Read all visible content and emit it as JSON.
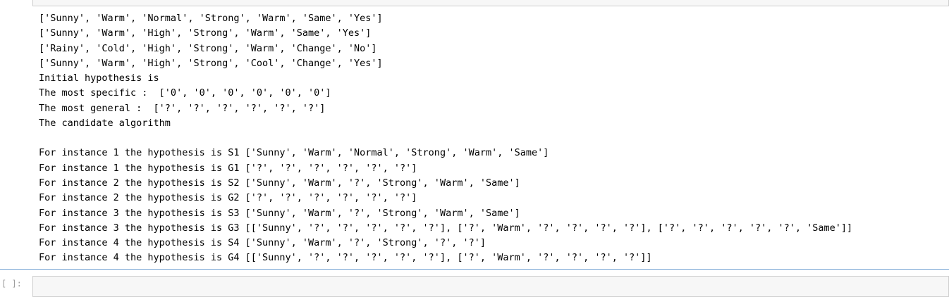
{
  "output": {
    "lines_top": [
      "['Sunny', 'Warm', 'Normal', 'Strong', 'Warm', 'Same', 'Yes']",
      "['Sunny', 'Warm', 'High', 'Strong', 'Warm', 'Same', 'Yes']",
      "['Rainy', 'Cold', 'High', 'Strong', 'Warm', 'Change', 'No']",
      "['Sunny', 'Warm', 'High', 'Strong', 'Cool', 'Change', 'Yes']",
      "Initial hypothesis is",
      "The most specific :  ['0', '0', '0', '0', '0', '0']",
      "The most general :  ['?', '?', '?', '?', '?', '?']",
      "The candidate algorithm"
    ],
    "lines_bottom": [
      "For instance 1 the hypothesis is S1 ['Sunny', 'Warm', 'Normal', 'Strong', 'Warm', 'Same']",
      "For instance 1 the hypothesis is G1 ['?', '?', '?', '?', '?', '?']",
      "For instance 2 the hypothesis is S2 ['Sunny', 'Warm', '?', 'Strong', 'Warm', 'Same']",
      "For instance 2 the hypothesis is G2 ['?', '?', '?', '?', '?', '?']",
      "For instance 3 the hypothesis is S3 ['Sunny', 'Warm', '?', 'Strong', 'Warm', 'Same']",
      "For instance 3 the hypothesis is G3 [['Sunny', '?', '?', '?', '?', '?'], ['?', 'Warm', '?', '?', '?', '?'], ['?', '?', '?', '?', '?', 'Same']]",
      "For instance 4 the hypothesis is S4 ['Sunny', 'Warm', '?', 'Strong', '?', '?']",
      "For instance 4 the hypothesis is G4 [['Sunny', '?', '?', '?', '?', '?'], ['?', 'Warm', '?', '?', '?', '?']]"
    ]
  },
  "next_cell": {
    "prompt": "[ ]:"
  }
}
